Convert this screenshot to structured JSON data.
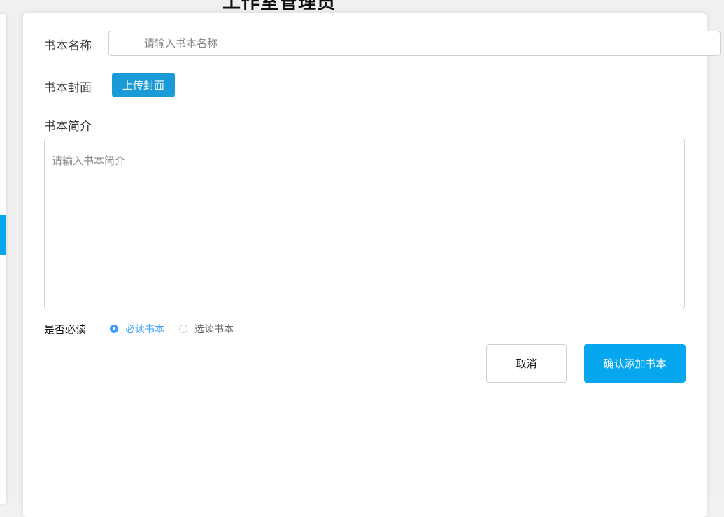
{
  "page": {
    "heading": "工作室管理员"
  },
  "form": {
    "name": {
      "label": "书本名称",
      "placeholder": "请输入书本名称",
      "value": ""
    },
    "cover": {
      "label": "书本封面",
      "upload_label": "上传封面"
    },
    "intro": {
      "label": "书本简介",
      "placeholder": "请输入书本简介",
      "value": ""
    },
    "required": {
      "label": "是否必读",
      "options": [
        {
          "label": "必读书本",
          "checked": true
        },
        {
          "label": "选读书本",
          "checked": false
        }
      ]
    },
    "actions": {
      "cancel_label": "取消",
      "confirm_label": "确认添加书本"
    }
  },
  "colors": {
    "accent": "#06a7ef",
    "upload_button": "#1a9bd8",
    "radio_checked": "#409eff"
  }
}
